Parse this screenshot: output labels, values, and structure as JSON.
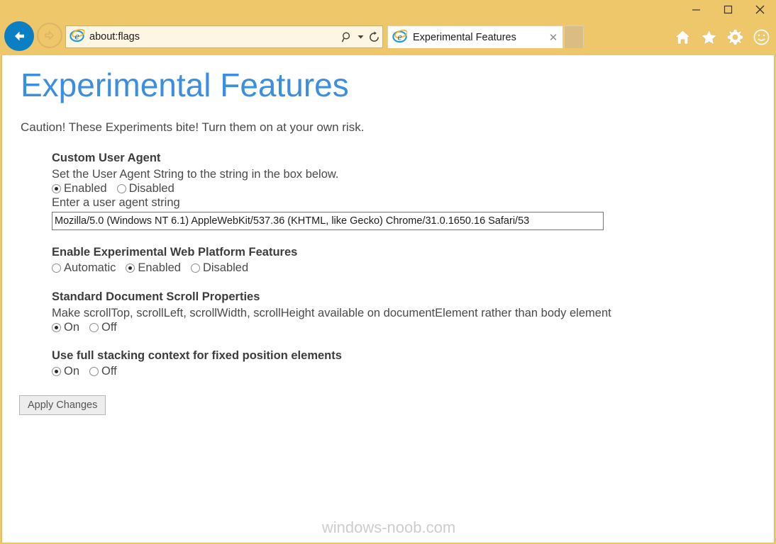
{
  "browser": {
    "chrome_color": "#eec76a",
    "window_controls": [
      {
        "name": "minimize",
        "glyph": "—"
      },
      {
        "name": "maximize",
        "glyph": "□"
      },
      {
        "name": "close",
        "glyph": "✕"
      }
    ],
    "back_label": "Back",
    "forward_label": "Forward",
    "address": {
      "value": "about:flags",
      "placeholder": "Search or enter web address",
      "search_icon": "search-icon",
      "dropdown_icon": "chevron-down-icon",
      "refresh_icon": "refresh-icon"
    },
    "tab": {
      "title": "Experimental Features",
      "close_glyph": "✕",
      "favicon": "internet-explorer-icon"
    },
    "new_tab_label": "",
    "command_icons": [
      {
        "name": "home-icon"
      },
      {
        "name": "favorites-star-icon"
      },
      {
        "name": "settings-gear-icon"
      },
      {
        "name": "smiley-feedback-icon"
      }
    ]
  },
  "page": {
    "title": "Experimental Features",
    "title_color": "#3b8ee0",
    "caution": "Caution! These Experiments bite! Turn them on at your own risk.",
    "sections": [
      {
        "title": "Custom User Agent",
        "description": "Set the User Agent String to the string in the box below.",
        "options": [
          {
            "label": "Enabled",
            "checked": true
          },
          {
            "label": "Disabled",
            "checked": false
          }
        ],
        "input_label": "Enter a user agent string",
        "input_value": "Mozilla/5.0 (Windows NT 6.1) AppleWebKit/537.36 (KHTML, like Gecko) Chrome/31.0.1650.16 Safari/53",
        "input_placeholder": "Enter a user agent string"
      },
      {
        "title": "Enable Experimental Web Platform Features",
        "description": "",
        "options": [
          {
            "label": "Automatic",
            "checked": false
          },
          {
            "label": "Enabled",
            "checked": true
          },
          {
            "label": "Disabled",
            "checked": false
          }
        ]
      },
      {
        "title": "Standard Document Scroll Properties",
        "description": "Make scrollTop, scrollLeft, scrollWidth, scrollHeight available on documentElement rather than body element",
        "options": [
          {
            "label": "On",
            "checked": true
          },
          {
            "label": "Off",
            "checked": false
          }
        ]
      },
      {
        "title": "Use full stacking context for fixed position elements",
        "description": "",
        "options": [
          {
            "label": "On",
            "checked": true
          },
          {
            "label": "Off",
            "checked": false
          }
        ]
      }
    ],
    "apply_button": "Apply Changes",
    "watermark": "windows-noob.com"
  }
}
